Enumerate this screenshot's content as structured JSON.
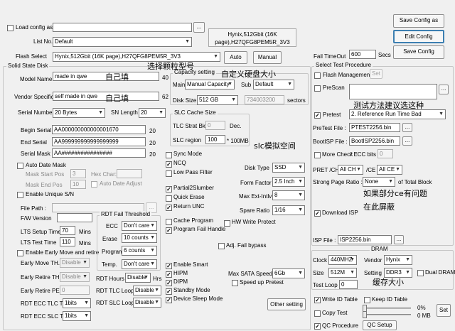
{
  "load_config": {
    "label": "Load config as",
    "browse": "..."
  },
  "list_no": {
    "label": "List No.",
    "value": "Default"
  },
  "chip_info": {
    "line1": "Hynix,512Gbit (16K",
    "line2": "page),H27QFG8PEM5R_3V3"
  },
  "flash_select": {
    "label": "Flash Select",
    "value": "Hynix,512Gbit (16K page),H27QFG8PEM5R_3V3",
    "auto": "Auto",
    "manual": "Manual"
  },
  "buttons": {
    "save_config_as": "Save Config as",
    "edit_config": "Edit Config",
    "save_config": "Save Config"
  },
  "fail_timeout": {
    "label": "Fail TimeOut",
    "value": "600",
    "unit": "Secs"
  },
  "solid_state_disk": {
    "title": "Solid State Disk",
    "model_label": "Model Name",
    "model_value": "made in qwe",
    "model_max": "40",
    "vendor_label": "Vendor Specific",
    "vendor_value": "self made in qwe",
    "vendor_max": "62",
    "serial_number_label": "Serial Number",
    "serial_number_value": "20 Bytes",
    "sn_length_label": "SN Length",
    "sn_length_value": "20",
    "begin_serial_label": "Begin Serial",
    "begin_serial_value": "AA000000000000001670",
    "begin_serial_len": "20",
    "end_serial_label": "End Serial",
    "end_serial_value": "AA999999999999999999",
    "end_serial_len": "20",
    "serial_mask_label": "Serial Mask",
    "serial_mask_value": "AA################",
    "serial_mask_len": "20",
    "auto_date_mask": "Auto Date Mask",
    "mask_start_pos_label": "Mask Start Pos",
    "mask_start_pos_value": "3",
    "hex_char_label": "Hex Char:",
    "mask_end_pos_label": "Mask End Pos",
    "mask_end_pos_value": "10",
    "auto_date_adjust": "Auto Date Adjust",
    "enable_unique_sn": "Enable Unique S/N",
    "file_path_label": "File Path :",
    "file_path_browse": "...",
    "fw_version_label": "F/W Version",
    "lts_setup_label": "LTS Setup Time",
    "lts_setup_value": "70",
    "lts_setup_unit": "Mins",
    "lts_test_label": "LTS Test Time",
    "lts_test_value": "110",
    "lts_test_unit": "Mins",
    "enable_early_move": "Enable Early Move and retire",
    "early_move_label": "Early Move TH.",
    "early_move_value": "Disable",
    "early_retire_label": "Early Retire TH.",
    "early_retire_value": "Disable",
    "early_retire_pe_label": "Early Retire PE",
    "early_retire_pe_value": "0",
    "ecc_tlc_label": "RDT ECC TLC TH",
    "ecc_tlc_value": "1bits",
    "ecc_slc_label": "RDT ECC SLC TH",
    "ecc_slc_value": "1bits"
  },
  "rdt_fail": {
    "title": "RDT Fail Threshold",
    "ecc_label": "ECC",
    "ecc_value": "Don't care",
    "erase_label": "Erase",
    "erase_value": "10 counts",
    "program_label": "Program",
    "program_value": "6 counts",
    "temp_label": "Temp.",
    "temp_value": "Don't care",
    "rdt_hours_label": "RDT Hours",
    "rdt_hours_value": "Disable",
    "rdt_hours_unit": "Hrs",
    "tlc_loops_label": "RDT TLC Loops",
    "tlc_loops_value": "Disable",
    "slc_loops_label": "RDT SLC Loops",
    "slc_loops_value": "Disable"
  },
  "capacity": {
    "title": "Capacity setting",
    "main_label": "Main",
    "main_value": "Manual Capacity",
    "sub_label": "Sub",
    "sub_value": "Default",
    "disk_size_label": "Disk Size",
    "disk_size_value": "512 GB",
    "sectors_value": "734003200",
    "sectors_unit": "sectors"
  },
  "slc_cache": {
    "title": "SLC Cache Size",
    "tlc_strat_label": "TLC Strat Bk",
    "tlc_strat_value": "0",
    "tlc_strat_unit": "Dec.",
    "slc_region_label": "SLC region",
    "slc_region_value": "100",
    "slc_region_unit": "* 100MB"
  },
  "options": {
    "sync_mode": "Sync Mode",
    "ncq": "NCQ",
    "low_pass_filter": "Low Pass Filter",
    "partial_slumber": "Partial2Slumber",
    "quick_erase": "Quick Erase",
    "return_unc": "Return UNC",
    "cache_program": "Cache Program",
    "program_fail_handle": "Program Fail Handle",
    "hw_write_protect": "HW Write Protect",
    "adj_fail_bypass": "Adj. Fail bypass",
    "enable_smart": "Enable Smart",
    "hipm": "HIPM",
    "dipm": "DIPM",
    "standby_mode": "Standby Mode",
    "device_sleep_mode": "Device Sleep Mode",
    "speed_up_pretest": "Speed up Pretest"
  },
  "disk_params": {
    "disk_type_label": "Disk Type",
    "disk_type_value": "SSD",
    "form_factor_label": "Form Factor",
    "form_factor_value": "2.5 Inch",
    "max_ext_label": "Max Ext-Intlv",
    "max_ext_value": "8",
    "spare_ratio_label": "Spare Ratio",
    "spare_ratio_value": "1/16",
    "max_sata_label": "Max SATA Speed",
    "max_sata_value": "6Gb",
    "other_setting": "Other setting"
  },
  "test_procedure": {
    "title": "Select Test Procedure",
    "flash_management": "Flash Management",
    "set1": "Set",
    "prescan": "PreScan",
    "prescan_browse": "...",
    "pretest": "Pretest",
    "pretest_value": "2. Reference Run Time Bad",
    "pretest_file_label": "PreTest File :",
    "pretest_file_value": "PTEST2256.bin",
    "pretest_browse": "...",
    "bootisp_label": "BootISP File :",
    "bootisp_value": "BootISP2256.bin",
    "bootisp_browse": "...",
    "more_check": "More Check",
    "ecc_bits": "/ ECC bits",
    "ecc_bits_value": "0",
    "pret_ch_label": "PRET /CH",
    "pret_ch_value": "All CH",
    "ce_label": "/CE",
    "ce_value": "All CE",
    "strong_page_label": "Strong Page Ratio :",
    "strong_page_value": "None",
    "total_block": "of Total Block",
    "download_isp": "Download ISP",
    "isp_file_label": "ISP File :",
    "isp_file_value": "ISP2256.bin",
    "isp_browse": "..."
  },
  "dram": {
    "title": "DRAM",
    "clock_label": "Clock",
    "clock_value": "440MHZ",
    "vendor_label": "Vendor",
    "vendor_value": "Hynix",
    "size_label": "Size",
    "size_value": "512M",
    "setting_label": "Setting",
    "setting_value": "DDR3",
    "dual_dram": "Dual DRAM",
    "test_loop_label": "Test Loop",
    "test_loop_value": "0"
  },
  "bottom_opts": {
    "write_id_table": "Write ID Table",
    "keep_id_table": "Keep ID Table",
    "copy_test": "Copy Test",
    "copy_pct": "0%",
    "copy_mb": "0 MB",
    "set2": "Set",
    "qc_procedure": "QC Procedure",
    "qc_setup": "QC Setup"
  },
  "annotations": {
    "a1": "选择颗粒型号",
    "a2": "自定义硬盘大小",
    "a3": "自己填",
    "a4": "自己填",
    "a5": "测试方法建议选这种",
    "a6": "slc模拟空间",
    "a7": "如果部分ce有问题",
    "a8": "在此屏蔽",
    "a9": "缓存大小"
  }
}
